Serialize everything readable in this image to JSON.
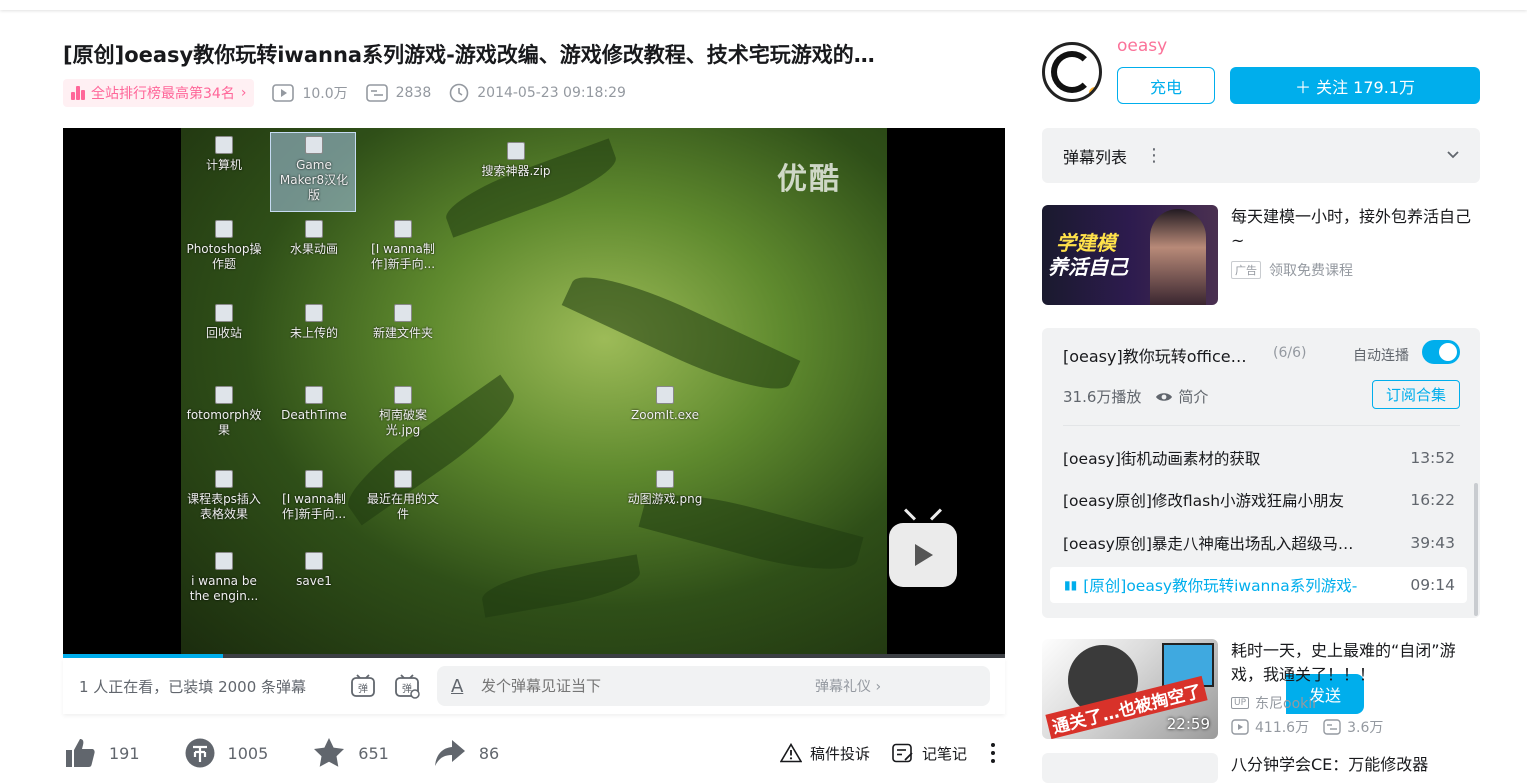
{
  "video": {
    "title": "[原创]oeasy教你玩转iwanna系列游戏-游戏改编、游戏修改教程、技术宅玩游戏的…",
    "rank_badge": "全站排行榜最高第34名",
    "play_count": "10.0万",
    "danmaku_count": "2838",
    "publish_time": "2014-05-23 09:18:29",
    "progress": 0.17,
    "watermark": "优酷"
  },
  "desktop_icons": [
    {
      "label": "计算机"
    },
    {
      "label": "Game Maker8汉化版"
    },
    {
      "label": "搜索神器.zip"
    },
    {
      "label": "Photoshop操作题"
    },
    {
      "label": "水果动画"
    },
    {
      "label": "[I wanna制作]新手向..."
    },
    {
      "label": "回收站"
    },
    {
      "label": "未上传的"
    },
    {
      "label": "新建文件夹"
    },
    {
      "label": "fotomorph效果"
    },
    {
      "label": "DeathTime"
    },
    {
      "label": "柯南破案光.jpg"
    },
    {
      "label": "ZoomIt.exe"
    },
    {
      "label": "课程表ps插入表格效果"
    },
    {
      "label": "[I wanna制作]新手向..."
    },
    {
      "label": "最近在用的文件"
    },
    {
      "label": "i wanna be the engin..."
    },
    {
      "label": "save1"
    },
    {
      "label": "动图游戏.png"
    }
  ],
  "danmaku_bar": {
    "watching": "1 人正在看，已装填 2000 条弹幕",
    "placeholder": "发个弹幕见证当下",
    "etiquette": "弹幕礼仪 ›",
    "send_label": "发送"
  },
  "actions": {
    "like": "191",
    "coin": "1005",
    "favorite": "651",
    "share": "86",
    "report": "稿件投诉",
    "notes": "记笔记"
  },
  "uploader": {
    "name": "oeasy",
    "charge_label": "充电",
    "follow_label": "＋ 关注 179.1万"
  },
  "danmaku_list": {
    "label": "弹幕列表"
  },
  "ad": {
    "title": "每天建模一小时，接外包养活自己~",
    "tag": "广告",
    "cta": "领取免费课程",
    "thumb_line1": "学建模",
    "thumb_line2": "养活自己"
  },
  "collection": {
    "title": "[oeasy]教你玩转office…",
    "count": "(6/6)",
    "autoplay_label": "自动连播",
    "autoplay_on": true,
    "plays": "31.6万播放",
    "intro_label": "简介",
    "subscribe_label": "订阅合集",
    "episodes": [
      {
        "title": "[oeasy]街机动画素材的获取",
        "duration": "13:52"
      },
      {
        "title": "[oeasy原创]修改flash小游戏狂扁小朋友",
        "duration": "16:22"
      },
      {
        "title": "[oeasy原创]暴走八神庵出场乱入超级马…",
        "duration": "39:43"
      },
      {
        "title": "[原创]oeasy教你玩转iwanna系列游戏-",
        "duration": "09:14"
      }
    ]
  },
  "recommend": [
    {
      "title": "耗时一天，史上最难的“自闭”游戏，我通关了！！！",
      "uploader": "东尼ookii",
      "uploader_tag": "UP",
      "plays": "411.6万",
      "danmaku": "3.6万",
      "duration": "22:59",
      "thumb_caption": "通关了…也被掏空了"
    },
    {
      "title": "八分钟学会CE：万能修改器"
    }
  ],
  "colors": {
    "accent": "#00aeec",
    "pink": "#fb7299",
    "rank_pink": "#ff6699"
  }
}
